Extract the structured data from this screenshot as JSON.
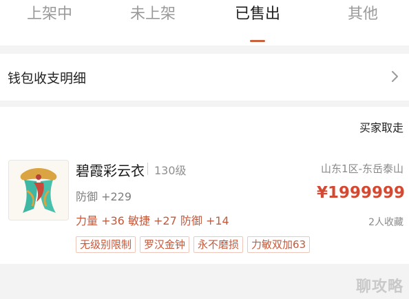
{
  "tabs": [
    {
      "label": "上架中",
      "active": false
    },
    {
      "label": "未上架",
      "active": false
    },
    {
      "label": "已售出",
      "active": true
    },
    {
      "label": "其他",
      "active": false
    }
  ],
  "wallet": {
    "label": "钱包收支明细",
    "icon": "chevron-right-icon"
  },
  "card": {
    "action_label": "买家取走",
    "item": {
      "name": "碧霞彩云衣",
      "level": "130级",
      "defense": "防御 +229",
      "attributes": "力量 +36 敏捷 +27 防御 +14",
      "server": "山东1区-东岳泰山",
      "price": "¥1999999",
      "favorites": "2人收藏",
      "tags": [
        "无级别限制",
        "罗汉金钟",
        "永不磨损",
        "力敏双加63"
      ]
    }
  },
  "watermark": "聊攻略",
  "colors": {
    "accent": "#c9613c",
    "price": "#d24a33",
    "attr_text": "#c4583a",
    "background": "#f3f3f3"
  }
}
